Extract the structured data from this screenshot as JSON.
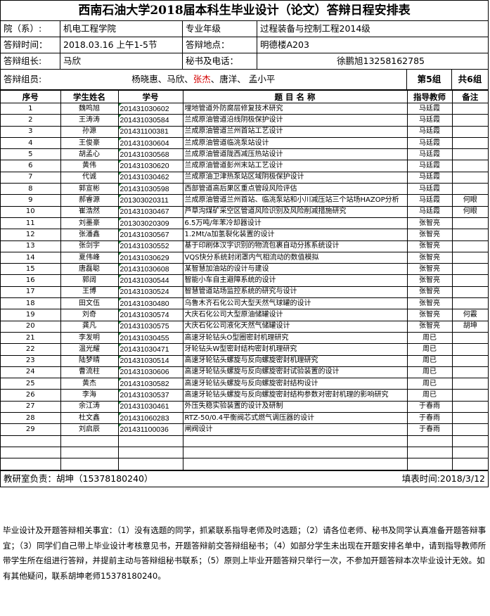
{
  "title": "西南石油大学2018届本科生毕业设计（论文）答辩日程安排表",
  "info": {
    "college_label": "院（系）:",
    "college_value": "机电工程学院",
    "major_label": "专业年级",
    "major_value": "过程装备与控制工程2014级",
    "time_label": "答辩时间：",
    "time_value": "2018.03.16 上午1-5节",
    "place_label": "答辩地点：",
    "place_value": "明德楼A203",
    "leader_label": "答辩组长:",
    "leader_value": "马欣",
    "secretary_label": "秘书及电话：",
    "secretary_value": "徐鹏旭13258162785"
  },
  "members": {
    "label": "答辩组员:",
    "names_a": "杨晓惠、马欣、",
    "names_red": "张杰",
    "names_b": "、唐洋、 孟小平",
    "group": "第5组",
    "total": "共6组"
  },
  "table": {
    "headers": [
      "序号",
      "学生姓名",
      "学号",
      "题 目 名 称",
      "指导教师",
      "备注"
    ],
    "rows": [
      [
        "1",
        "魏鸣旭",
        "201431030602",
        "埋地管道外防腐层修复技术研究",
        "马廷霞",
        ""
      ],
      [
        "2",
        "王涛涛",
        "201431030584",
        "兰成原油管道沿线阴极保护设计",
        "马廷霞",
        ""
      ],
      [
        "3",
        "孙源",
        "201431100381",
        "兰成原油管道兰州首站工艺设计",
        "马廷霞",
        ""
      ],
      [
        "4",
        "王俊豪",
        "201431030604",
        "兰成原油管道临洮泵站设计",
        "马廷霞",
        ""
      ],
      [
        "5",
        "胡孟心",
        "201431030568",
        "兰成原油管道陇西减压热站设计",
        "马廷霞",
        ""
      ],
      [
        "6",
        "黄伟",
        "201431030620",
        "兰成原油管道彭州末站工艺设计",
        "马廷霞",
        ""
      ],
      [
        "7",
        "代诚",
        "201431030462",
        "兰成原油卫津热泵站区域阴极保护设计",
        "马廷霞",
        ""
      ],
      [
        "8",
        "郭宣彬",
        "201431030598",
        "西部管道高后果区重点管段风险评估",
        "马廷霞",
        ""
      ],
      [
        "9",
        "郝睿源",
        "201303020311",
        "兰成原油管道兰州首站、临洮泵站和小川减压站三个站场HAZOP分析",
        "马廷霞",
        "何眼"
      ],
      [
        "10",
        "崔浩然",
        "201431030467",
        "芦草沟煤矿采空区管道风险识别及风险削减措施研究",
        "马廷霞",
        "何眼"
      ],
      [
        "11",
        "刘墨豪",
        "201303020309",
        "6.5万吨/年苯冷却器设计",
        "张智亮",
        ""
      ],
      [
        "12",
        "张潘鑫",
        "201431030567",
        "1.2Mt/a加氢裂化装置的设计",
        "张智亮",
        ""
      ],
      [
        "13",
        "张剑宇",
        "201431030552",
        "基于印刷体汉字识别的物流包裹自动分拣系统设计",
        "张智亮",
        ""
      ],
      [
        "14",
        "夏伟峰",
        "201431030629",
        "VQS快分系统封闭罩内气相流动的数值模拟",
        "张智亮",
        ""
      ],
      [
        "15",
        "唐磊聪",
        "201431030608",
        "某智慧加油站的设计与建设",
        "张智亮",
        ""
      ],
      [
        "16",
        "郭阔",
        "201431030544",
        "智能小车自主避障系统的设计",
        "张智亮",
        ""
      ],
      [
        "17",
        "王博",
        "201431030524",
        "智慧管道站场监控系统的研究与设计",
        "张智亮",
        ""
      ],
      [
        "18",
        "田文伍",
        "201431030480",
        "乌鲁木齐石化公司大型天然气球罐的设计",
        "张智亮",
        ""
      ],
      [
        "19",
        "刘奇",
        "201431030574",
        "大庆石化公司大型原油储罐设计",
        "张智亮",
        "何霰"
      ],
      [
        "20",
        "龚凡",
        "201431030575",
        "大庆石化公司液化天然气储罐设计",
        "张智亮",
        "胡坤"
      ],
      [
        "21",
        "李发明",
        "201431030455",
        "高速牙轮钻头O型圈密封机理研究",
        "周已",
        ""
      ],
      [
        "22",
        "温光耀",
        "201431030471",
        "牙轮钻头W型密封结构密封机理研究",
        "周已",
        ""
      ],
      [
        "23",
        "陆梦晴",
        "201431030514",
        "高速牙轮钻头螺旋与反向螺旋密封机理研究",
        "周已",
        ""
      ],
      [
        "24",
        "曹流柱",
        "201431030606",
        "高速牙轮钻头螺旋与反向螺旋密封试验装置的设计",
        "周已",
        ""
      ],
      [
        "25",
        "黄杰",
        "201431030582",
        "高速牙轮钻头螺旋与反向螺旋密封结构设计",
        "周已",
        ""
      ],
      [
        "26",
        "李海",
        "201431030537",
        "高速牙轮钻头螺旋与反向螺旋密封结构参数对密封机理的影响研究",
        "周已",
        ""
      ],
      [
        "27",
        "余江涛",
        "201431030461",
        "外压失稳实验装置的设计及研制",
        "于春雨",
        ""
      ],
      [
        "28",
        "杜文鑫",
        "201431060283",
        "RTZ-50/0.4平衡阀芯式燃气调压器的设计",
        "于春雨",
        ""
      ],
      [
        "29",
        "刘启辰",
        "201431100036",
        "闸阀设计",
        "于春雨",
        ""
      ]
    ]
  },
  "footer": {
    "office": "教研室负责：胡坤（15378180240）",
    "date": "填表时间:2018/3/12"
  },
  "notes": "毕业设计及开题答辩相关事宜：（1）没有选题的同学，抓紧联系指导老师及时选题；（2）请各位老师、秘书及同学认真准备开题答辩事宜；（3）同学们自己带上毕业设计考核意见书，开题答辩前交答辩组秘书；（4）如部分学生未出现在开题安排名单中，请到指导教师所带学生所在组进行答辩，并提前主动与答辩组秘书联系；（5）原则上毕业开题答辩只举行一次，不参加开题答辩本次毕业设计无效。如有其他疑问，联系胡坤老师15378180240。"
}
